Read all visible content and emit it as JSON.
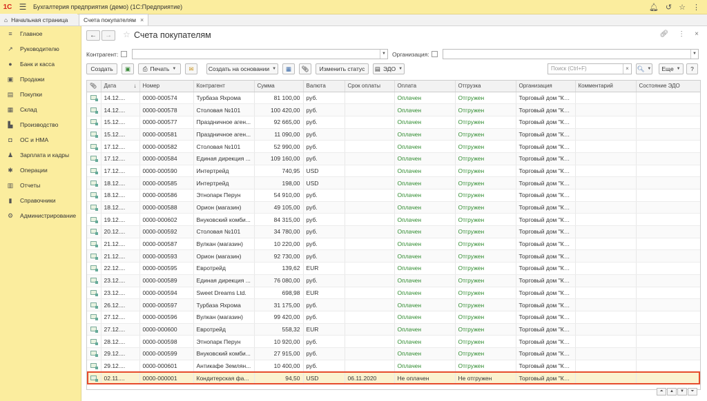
{
  "app": {
    "logo": "1С",
    "title": "Бухгалтерия предприятия (демо)  (1С:Предприятие)"
  },
  "tabs": {
    "home": "Начальная страница",
    "current": "Счета покупателям"
  },
  "sidebar": {
    "items": [
      {
        "label": "Главное",
        "icon": "menu-icon"
      },
      {
        "label": "Руководителю",
        "icon": "chart-line-icon"
      },
      {
        "label": "Банк и касса",
        "icon": "coin-icon"
      },
      {
        "label": "Продажи",
        "icon": "cart-icon"
      },
      {
        "label": "Покупки",
        "icon": "basket-icon"
      },
      {
        "label": "Склад",
        "icon": "warehouse-icon"
      },
      {
        "label": "Производство",
        "icon": "factory-icon"
      },
      {
        "label": "ОС и НМА",
        "icon": "car-icon"
      },
      {
        "label": "Зарплата и кадры",
        "icon": "person-icon"
      },
      {
        "label": "Операции",
        "icon": "gear-icon"
      },
      {
        "label": "Отчеты",
        "icon": "bar-chart-icon"
      },
      {
        "label": "Справочники",
        "icon": "book-icon"
      },
      {
        "label": "Администрирование",
        "icon": "settings-icon"
      }
    ]
  },
  "page": {
    "title": "Счета покупателям"
  },
  "filters": {
    "counterparty_label": "Контрагент:",
    "organization_label": "Организация:"
  },
  "toolbar": {
    "create": "Создать",
    "print": "Печать",
    "create_based_on": "Создать на основании",
    "change_status": "Изменить статус",
    "edo": "ЭДО",
    "search_placeholder": "Поиск (Ctrl+F)",
    "more": "Еще",
    "help": "?"
  },
  "table": {
    "columns": [
      "Дата",
      "Номер",
      "Контрагент",
      "Сумма",
      "Валюта",
      "Срок оплаты",
      "Оплата",
      "Отгрузка",
      "Организация",
      "Комментарий",
      "Состояние ЭДО"
    ],
    "rows": [
      [
        "14.12....",
        "0000-000574",
        "Турбаза Яхрома",
        "81 100,00",
        "руб.",
        "",
        "Оплачен",
        "Отгружен",
        "Торговый дом \"Ко...",
        "",
        ""
      ],
      [
        "14.12....",
        "0000-000578",
        "Столовая №101",
        "100 420,00",
        "руб.",
        "",
        "Оплачен",
        "Отгружен",
        "Торговый дом \"Ко...",
        "",
        ""
      ],
      [
        "15.12....",
        "0000-000577",
        "Праздничное аген...",
        "92 665,00",
        "руб.",
        "",
        "Оплачен",
        "Отгружен",
        "Торговый дом \"Ко...",
        "",
        ""
      ],
      [
        "15.12....",
        "0000-000581",
        "Праздничное аген...",
        "11 090,00",
        "руб.",
        "",
        "Оплачен",
        "Отгружен",
        "Торговый дом \"Ко...",
        "",
        ""
      ],
      [
        "17.12....",
        "0000-000582",
        "Столовая №101",
        "52 990,00",
        "руб.",
        "",
        "Оплачен",
        "Отгружен",
        "Торговый дом \"Ко...",
        "",
        ""
      ],
      [
        "17.12....",
        "0000-000584",
        "Единая дирекция ...",
        "109 160,00",
        "руб.",
        "",
        "Оплачен",
        "Отгружен",
        "Торговый дом \"Ко...",
        "",
        ""
      ],
      [
        "17.12....",
        "0000-000590",
        "Интертрейд",
        "740,95",
        "USD",
        "",
        "Оплачен",
        "Отгружен",
        "Торговый дом \"Ко...",
        "",
        ""
      ],
      [
        "18.12....",
        "0000-000585",
        "Интертрейд",
        "198,00",
        "USD",
        "",
        "Оплачен",
        "Отгружен",
        "Торговый дом \"Ко...",
        "",
        ""
      ],
      [
        "18.12....",
        "0000-000586",
        "Этнопарк Перун",
        "54 910,00",
        "руб.",
        "",
        "Оплачен",
        "Отгружен",
        "Торговый дом \"Ко...",
        "",
        ""
      ],
      [
        "18.12....",
        "0000-000588",
        "Орион (магазин)",
        "49 105,00",
        "руб.",
        "",
        "Оплачен",
        "Отгружен",
        "Торговый дом \"Ко...",
        "",
        ""
      ],
      [
        "19.12....",
        "0000-000602",
        "Внуковский комби...",
        "84 315,00",
        "руб.",
        "",
        "Оплачен",
        "Отгружен",
        "Торговый дом \"Ко...",
        "",
        ""
      ],
      [
        "20.12....",
        "0000-000592",
        "Столовая №101",
        "34 780,00",
        "руб.",
        "",
        "Оплачен",
        "Отгружен",
        "Торговый дом \"Ко...",
        "",
        ""
      ],
      [
        "21.12....",
        "0000-000587",
        "Вулкан (магазин)",
        "10 220,00",
        "руб.",
        "",
        "Оплачен",
        "Отгружен",
        "Торговый дом \"Ко...",
        "",
        ""
      ],
      [
        "21.12....",
        "0000-000593",
        "Орион (магазин)",
        "92 730,00",
        "руб.",
        "",
        "Оплачен",
        "Отгружен",
        "Торговый дом \"Ко...",
        "",
        ""
      ],
      [
        "22.12....",
        "0000-000595",
        "Евротрейд",
        "139,62",
        "EUR",
        "",
        "Оплачен",
        "Отгружен",
        "Торговый дом \"Ко...",
        "",
        ""
      ],
      [
        "23.12....",
        "0000-000589",
        "Единая дирекция ...",
        "76 080,00",
        "руб.",
        "",
        "Оплачен",
        "Отгружен",
        "Торговый дом \"Ко...",
        "",
        ""
      ],
      [
        "23.12....",
        "0000-000594",
        "Sweet Dreams Ltd.",
        "698,98",
        "EUR",
        "",
        "Оплачен",
        "Отгружен",
        "Торговый дом \"Ко...",
        "",
        ""
      ],
      [
        "26.12....",
        "0000-000597",
        "Турбаза Яхрома",
        "31 175,00",
        "руб.",
        "",
        "Оплачен",
        "Отгружен",
        "Торговый дом \"Ко...",
        "",
        ""
      ],
      [
        "27.12....",
        "0000-000596",
        "Вулкан (магазин)",
        "99 420,00",
        "руб.",
        "",
        "Оплачен",
        "Отгружен",
        "Торговый дом \"Ко...",
        "",
        ""
      ],
      [
        "27.12....",
        "0000-000600",
        "Евротрейд",
        "558,32",
        "EUR",
        "",
        "Оплачен",
        "Отгружен",
        "Торговый дом \"Ко...",
        "",
        ""
      ],
      [
        "28.12....",
        "0000-000598",
        "Этнопарк Перун",
        "10 920,00",
        "руб.",
        "",
        "Оплачен",
        "Отгружен",
        "Торговый дом \"Ко...",
        "",
        ""
      ],
      [
        "29.12....",
        "0000-000599",
        "Внуковский комби...",
        "27 915,00",
        "руб.",
        "",
        "Оплачен",
        "Отгружен",
        "Торговый дом \"Ко...",
        "",
        ""
      ],
      [
        "29.12....",
        "0000-000601",
        "Антикафе Землян...",
        "10 400,00",
        "руб.",
        "",
        "Оплачен",
        "Отгружен",
        "Торговый дом \"Ко...",
        "",
        ""
      ],
      [
        "02.11....",
        "0000-000001",
        "Кондитерская фа...",
        "94,50",
        "USD",
        "06.11.2020",
        "Не оплачен",
        "Не отгружен",
        "Торговый дом \"Ко...",
        "",
        ""
      ]
    ],
    "selected_row": 23
  },
  "colors": {
    "sidebar_bg": "#fbed9e",
    "status_green": "#2e8b2e",
    "selection_outline": "#e64b2c"
  }
}
